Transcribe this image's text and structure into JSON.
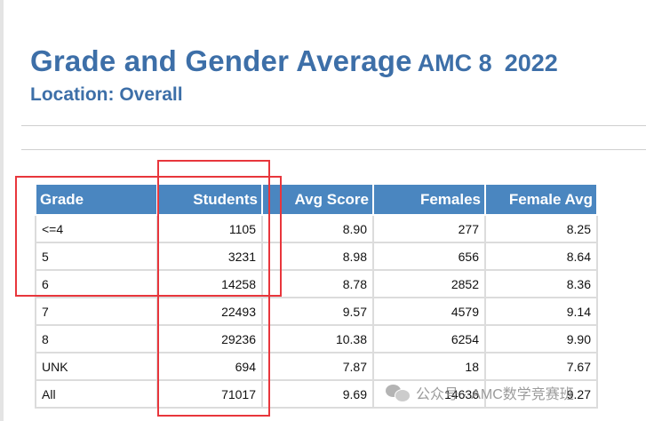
{
  "report": {
    "title": "Grade and Gender Average",
    "contest": "AMC 8",
    "year": "2022",
    "location": "Location: Overall"
  },
  "table": {
    "headers": [
      "Grade",
      "Students",
      "Avg Score",
      "Females",
      "Female Avg"
    ],
    "rows": [
      [
        "<=4",
        "1105",
        "8.90",
        "277",
        "8.25"
      ],
      [
        "5",
        "3231",
        "8.98",
        "656",
        "8.64"
      ],
      [
        "6",
        "14258",
        "8.78",
        "2852",
        "8.36"
      ],
      [
        "7",
        "22493",
        "9.57",
        "4579",
        "9.14"
      ],
      [
        "8",
        "29236",
        "10.38",
        "6254",
        "9.90"
      ],
      [
        "UNK",
        "694",
        "7.87",
        "18",
        "7.67"
      ],
      [
        "All",
        "71017",
        "9.69",
        "14636",
        "9.27"
      ]
    ]
  },
  "watermark": {
    "text": "公众号 · AMC数学竞赛班",
    "icon": "wechat-icon"
  },
  "colors": {
    "header_bg": "#4a86c0",
    "title": "#3d6fa8",
    "annotation": "#e8363c"
  }
}
